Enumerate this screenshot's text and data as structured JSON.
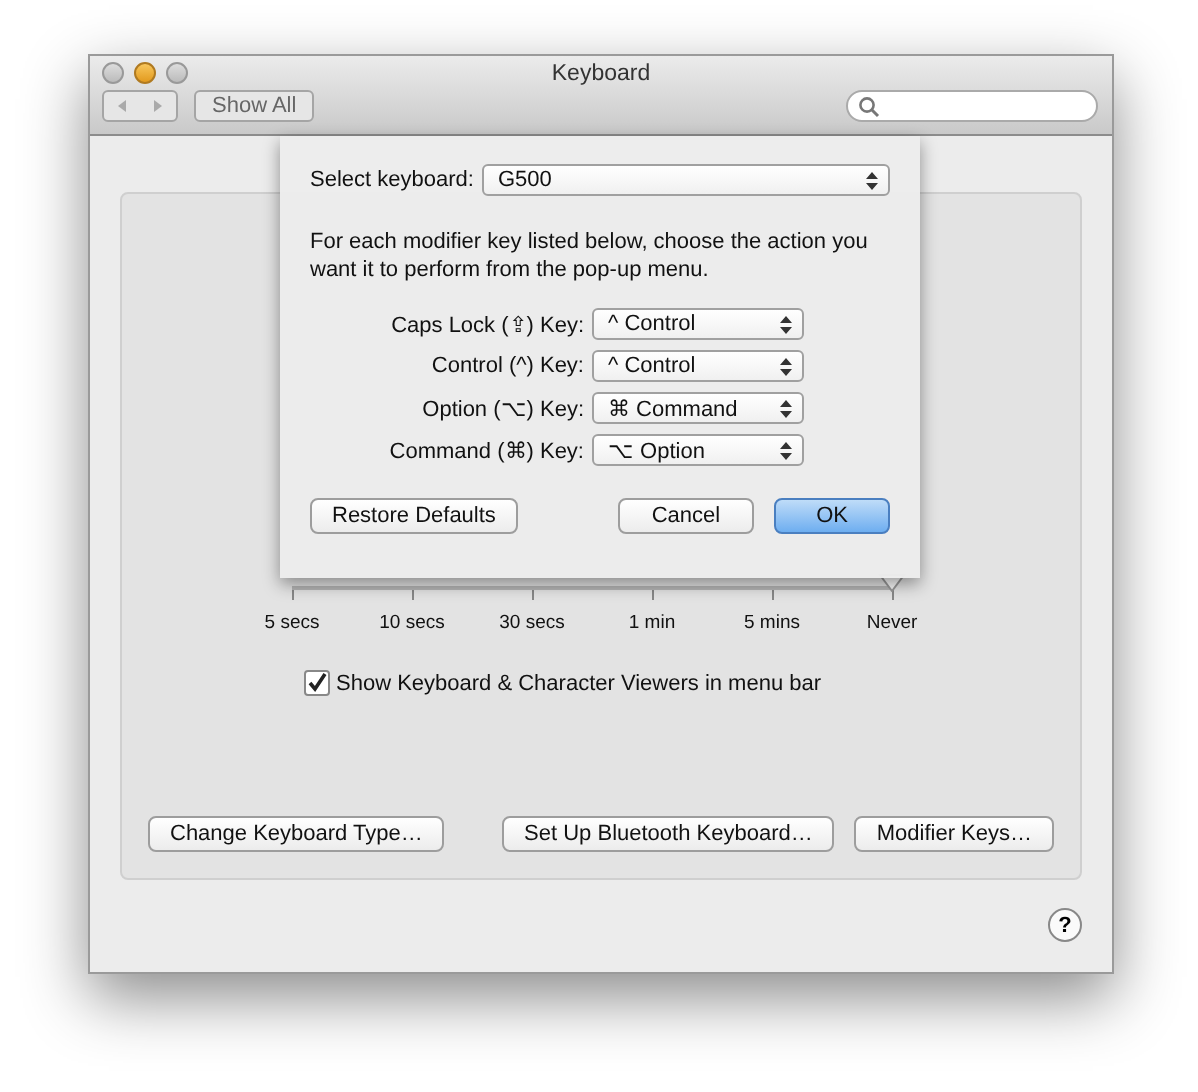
{
  "window": {
    "title": "Keyboard",
    "show_all": "Show All"
  },
  "slider": {
    "level": 1,
    "labels": [
      "5 secs",
      "10 secs",
      "30 secs",
      "1 min",
      "5 mins",
      "Never"
    ]
  },
  "viewer_checkbox": {
    "label": "Show Keyboard & Character Viewers in menu bar",
    "checked": true
  },
  "buttons": [
    "Change Keyboard Type…",
    "Set Up Bluetooth Keyboard…",
    "Modifier Keys…"
  ],
  "help": "?",
  "sheet": {
    "select_label": "Select keyboard:",
    "keyboard": "G500",
    "instructions": "For each modifier key listed below, choose the action you want it to perform from the pop-up menu.",
    "mappings": [
      {
        "key": "Caps Lock (⇪) Key:",
        "action": "^ Control"
      },
      {
        "key": "Control (^) Key:",
        "action": "^ Control"
      },
      {
        "key": "Option (⌥) Key:",
        "action": "⌘ Command"
      },
      {
        "key": "Command (⌘) Key:",
        "action": "⌥ Option"
      }
    ],
    "restore": "Restore Defaults",
    "cancel": "Cancel",
    "ok": "OK"
  }
}
